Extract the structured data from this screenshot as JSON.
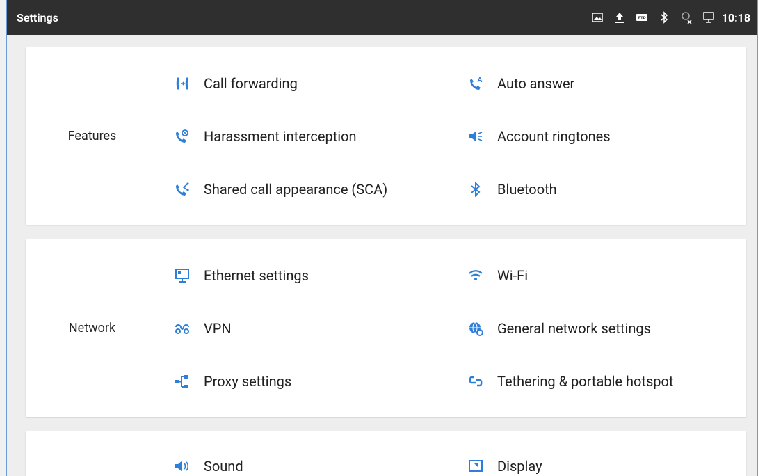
{
  "statusbar": {
    "title": "Settings",
    "icons": [
      "screenshot-icon",
      "upload-icon",
      "ftp-icon",
      "bluetooth-icon",
      "no-sim-icon",
      "ethernet-icon"
    ],
    "time": "10:18"
  },
  "accent_color": "#2d7fd9",
  "sections": [
    {
      "category": "Features",
      "items": [
        {
          "label": "Call forwarding",
          "icon": "call-forwarding-icon"
        },
        {
          "label": "Auto answer",
          "icon": "auto-answer-icon"
        },
        {
          "label": "Harassment interception",
          "icon": "harassment-interception-icon"
        },
        {
          "label": "Account ringtones",
          "icon": "ringtone-icon"
        },
        {
          "label": "Shared call appearance (SCA)",
          "icon": "shared-call-icon"
        },
        {
          "label": "Bluetooth",
          "icon": "bluetooth-icon"
        }
      ]
    },
    {
      "category": "Network",
      "items": [
        {
          "label": "Ethernet settings",
          "icon": "ethernet-icon"
        },
        {
          "label": "Wi-Fi",
          "icon": "wifi-icon"
        },
        {
          "label": "VPN",
          "icon": "vpn-icon"
        },
        {
          "label": "General network settings",
          "icon": "globe-gear-icon"
        },
        {
          "label": "Proxy settings",
          "icon": "proxy-icon"
        },
        {
          "label": "Tethering & portable hotspot",
          "icon": "hotspot-icon"
        }
      ]
    },
    {
      "category": "",
      "items": [
        {
          "label": "Sound",
          "icon": "speaker-icon"
        },
        {
          "label": "Display",
          "icon": "display-icon"
        }
      ]
    }
  ]
}
